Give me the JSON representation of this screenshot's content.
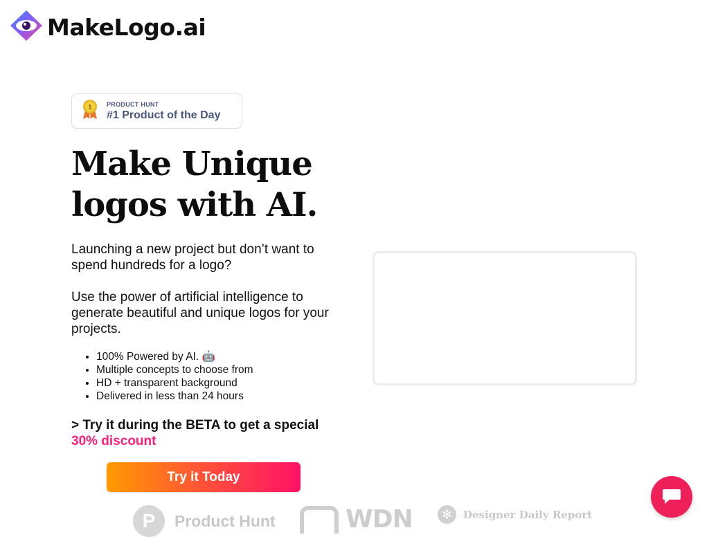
{
  "brand": {
    "name": "MakeLogo.ai"
  },
  "product_hunt_badge": {
    "small_label": "PRODUCT HUNT",
    "title": "#1 Product of the Day",
    "medal_number": "1"
  },
  "hero": {
    "headline": "Make Unique logos with AI.",
    "paragraph_1": "Launching a new project but don’t want to spend hundreds for a logo?",
    "paragraph_2": "Use the power of artificial intelligence to generate beautiful and unique logos for your projects.",
    "features": [
      "100% Powered by AI. 🤖",
      "Multiple concepts to choose from",
      "HD + transparent background",
      "Delivered in less than 24 hours"
    ],
    "beta_text": "> Try it during the BETA to get a special",
    "beta_discount": "30% discount",
    "cta_label": "Try it Today"
  },
  "press": {
    "product_hunt": {
      "letter": "P",
      "name": "Product Hunt"
    },
    "wdn": {
      "name": "WDN"
    },
    "designer_daily": {
      "name": "Designer Daily Report"
    }
  },
  "colors": {
    "accent_pink": "#ff1f7a",
    "cta_start": "#ff9a00",
    "cta_end": "#ff1266",
    "chat": "#ef1f5a",
    "badge_text": "#4b587c"
  },
  "icons": {
    "logo": "eye-icon",
    "medal": "medal-icon",
    "chat": "chat-icon"
  }
}
